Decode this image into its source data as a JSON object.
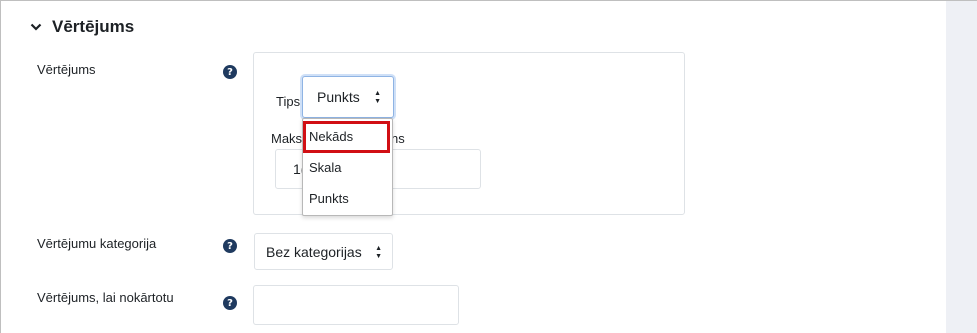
{
  "section": {
    "title": "Vērtējums",
    "toggle_icon": "chevron-down-icon"
  },
  "grade": {
    "label": "Vērtējums",
    "help_icon": "question-circle-icon",
    "help_glyph": "?",
    "type_label": "Tips",
    "type_selected": "Punkts",
    "type_arrows": [
      "▲",
      "▼"
    ],
    "max_label_start": "Maks",
    "max_label_end": "ns",
    "max_value_partial": "1(",
    "dropdown_options": [
      "Nekāds",
      "Skala",
      "Punkts"
    ],
    "highlighted_option": "Nekāds",
    "highlight_color": "#d10f14"
  },
  "category": {
    "label": "Vērtējumu kategorija",
    "help_glyph": "?",
    "selected": "Bez kategorijas",
    "arrows": [
      "▲",
      "▼"
    ]
  },
  "pass_grade": {
    "label": "Vērtējums, lai nokārtotu",
    "help_glyph": "?",
    "value": ""
  }
}
